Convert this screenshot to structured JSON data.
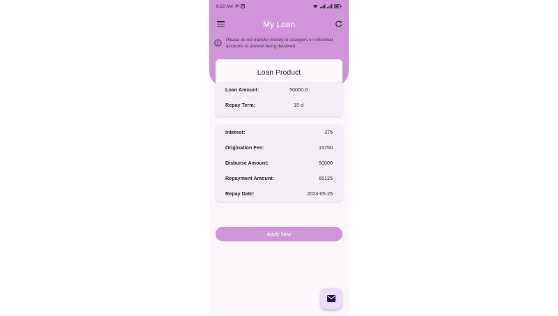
{
  "status_bar": {
    "time": "8:22 AM",
    "indicators": "P",
    "right_icons": "wifi-signal-battery-icons"
  },
  "header": {
    "title": "My Loan",
    "notice": "Please do not transfer money to strangers or unfamiliar accounts to prevent being deceived."
  },
  "loan_product": {
    "title": "Loan Product",
    "amount_label": "Loan  Amount:",
    "amount_value": "50000.0",
    "term_label": "Repay  Term:",
    "term_value": "15 d"
  },
  "details": {
    "interest_label": "Interest:",
    "interest_value": "375",
    "origination_label": "Origination Fee:",
    "origination_value": "15750",
    "disburse_label": "Disburse Amount:",
    "disburse_value": "50000",
    "repayment_label": "Repayment Amount:",
    "repayment_value": "66125",
    "repay_date_label": "Repay Date:",
    "repay_date_value": "2024-05-25"
  },
  "actions": {
    "apply_label": "Apply  Now"
  },
  "colors": {
    "accent": "#cf95d8",
    "background": "#fcf6fb",
    "card": "#f5eef6",
    "fab": "#eadcfa"
  },
  "icons": {
    "menu": "menu-icon",
    "refresh": "refresh-icon",
    "info": "info-icon",
    "fab": "mail-icon"
  }
}
